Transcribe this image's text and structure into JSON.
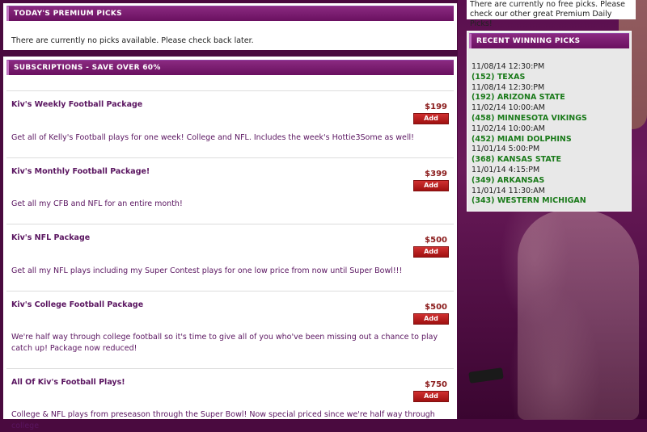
{
  "premium": {
    "title": "TODAY'S PREMIUM PICKS",
    "message": "There are currently no picks available. Please check back later."
  },
  "subscriptions": {
    "title": "SUBSCRIPTIONS - SAVE OVER 60%",
    "add_label": "Add",
    "packages": [
      {
        "name": "Kiv's Weekly Football Package",
        "price": "$199",
        "description": "Get all of Kelly's Football plays for one week! College and NFL. Includes the week's Hottie3Some as well!"
      },
      {
        "name": "Kiv's Monthly Football Package!",
        "price": "$399",
        "description": "Get all my CFB and NFL for an entire month!"
      },
      {
        "name": "Kiv's NFL Package",
        "price": "$500",
        "description": "Get all my NFL plays including my Super Contest plays for one low price from now until Super Bowl!!!"
      },
      {
        "name": "Kiv's College Football Package",
        "price": "$500",
        "description": "We're half way through college football so it's time to give all of you who've been missing out a chance to play catch up! Package now reduced!"
      },
      {
        "name": "All Of Kiv's Football Plays!",
        "price": "$750",
        "description": "College & NFL plays from preseason through the Super Bowl! Now special priced since we're half way through college"
      }
    ]
  },
  "free_note": "There are currently no free picks. Please check our other great Premium Daily Picks!",
  "recent": {
    "title": "RECENT WINNING PICKS",
    "items": [
      {
        "time": "11/08/14 12:30:PM",
        "team": "(152) TEXAS"
      },
      {
        "time": "11/08/14 12:30:PM",
        "team": "(192) ARIZONA STATE"
      },
      {
        "time": "11/02/14 10:00:AM",
        "team": "(458) MINNESOTA VIKINGS"
      },
      {
        "time": "11/02/14 10:00:AM",
        "team": "(452) MIAMI DOLPHINS"
      },
      {
        "time": "11/01/14 5:00:PM",
        "team": "(368) KANSAS STATE"
      },
      {
        "time": "11/01/14 4:15:PM",
        "team": "(349) ARKANSAS"
      },
      {
        "time": "11/01/14 11:30:AM",
        "team": "(343) WESTERN MICHIGAN"
      }
    ]
  }
}
